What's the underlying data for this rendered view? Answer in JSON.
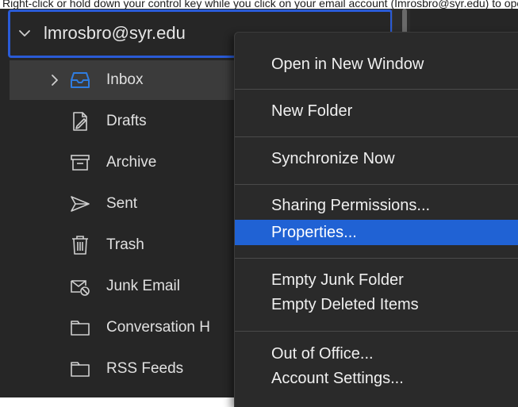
{
  "caption": "Right-click or hold down your control key while you click on your email account (Imrosbro@syr.edu) to open the menu",
  "account": {
    "label": "lmrosbro@syr.edu"
  },
  "folders": [
    {
      "label": "Inbox",
      "icon": "inbox-icon",
      "selected": true
    },
    {
      "label": "Drafts",
      "icon": "drafts-icon"
    },
    {
      "label": "Archive",
      "icon": "archive-icon"
    },
    {
      "label": "Sent",
      "icon": "sent-icon"
    },
    {
      "label": "Trash",
      "icon": "trash-icon"
    },
    {
      "label": "Junk Email",
      "icon": "junk-email-icon"
    },
    {
      "label": "Conversation H",
      "icon": "folder-icon"
    },
    {
      "label": "RSS Feeds",
      "icon": "folder-icon"
    }
  ],
  "context_menu": {
    "items": [
      {
        "label": "Open in New Window"
      },
      {
        "label": "New Folder"
      },
      {
        "label": "Synchronize Now"
      },
      {
        "label": "Sharing Permissions..."
      },
      {
        "label": "Properties...",
        "highlighted": true
      },
      {
        "label": "Empty Junk Folder"
      },
      {
        "label": "Empty Deleted Items"
      },
      {
        "label": "Out of Office..."
      },
      {
        "label": "Account Settings..."
      }
    ]
  },
  "colors": {
    "sidebar_bg": "#262626",
    "menu_bg": "#2a2a2a",
    "accent": "#2062d4",
    "focus_ring": "#2a5bd6",
    "inbox_icon": "#2f7de1"
  }
}
